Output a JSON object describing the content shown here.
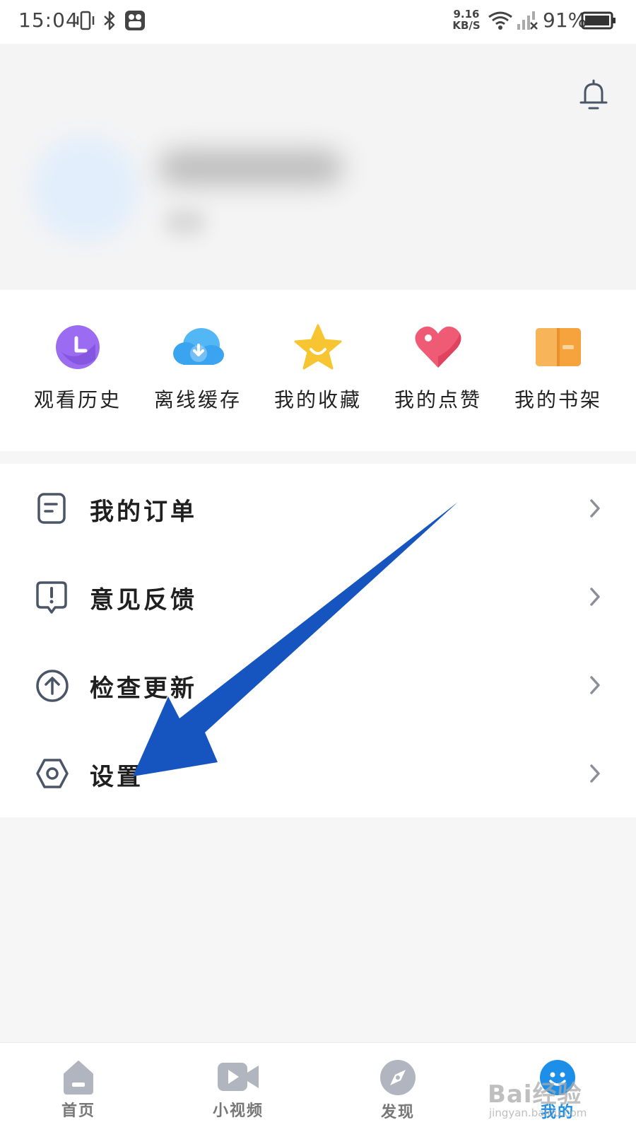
{
  "status_bar": {
    "time": "15:04",
    "speed_value": "9.16",
    "speed_unit": "KB/S",
    "battery": "91%"
  },
  "quick_actions": [
    {
      "label": "观看历史",
      "icon": "history-clock-icon",
      "color": "#9b6cf2"
    },
    {
      "label": "离线缓存",
      "icon": "cloud-download-icon",
      "color": "#3aa4f0"
    },
    {
      "label": "我的收藏",
      "icon": "star-icon",
      "color": "#f7c531"
    },
    {
      "label": "我的点赞",
      "icon": "heart-icon",
      "color": "#ef5a74"
    },
    {
      "label": "我的书架",
      "icon": "book-icon",
      "color": "#f6a33e"
    }
  ],
  "menu": [
    {
      "label": "我的订单",
      "icon": "order-icon"
    },
    {
      "label": "意见反馈",
      "icon": "feedback-icon"
    },
    {
      "label": "检查更新",
      "icon": "update-arrow-icon"
    },
    {
      "label": "设置",
      "icon": "settings-hexagon-icon"
    }
  ],
  "tabbar": [
    {
      "label": "首页",
      "icon": "home-icon"
    },
    {
      "label": "小视频",
      "icon": "video-icon"
    },
    {
      "label": "发现",
      "icon": "compass-icon"
    },
    {
      "label": "我的",
      "icon": "profile-icon",
      "active": true
    }
  ],
  "colors": {
    "accent": "#1e8fe8",
    "annotation_arrow": "#1655c0"
  },
  "watermark": {
    "main": "Bai经验",
    "sub": "jingyan.baidu.com"
  }
}
